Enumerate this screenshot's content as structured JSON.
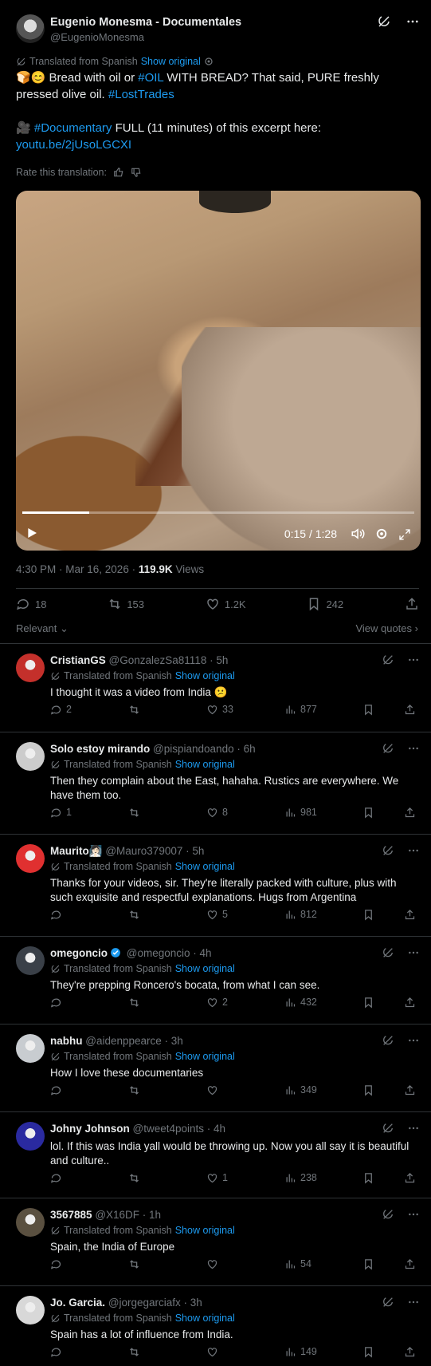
{
  "post": {
    "author_name": "Eugenio Monesma - Documentales",
    "author_handle": "@EugenioMonesma",
    "translated_label": "Translated from Spanish",
    "show_original": "Show original",
    "text_line1_emoji": "🍞😊",
    "text_line1_a": " Bread with oil or ",
    "hashtag_oil": "#OIL",
    "text_line1_b": " WITH BREAD? That said, PURE freshly pressed olive oil. ",
    "hashtag_lost": "#LostTrades",
    "text_line2_emoji": "🎥 ",
    "hashtag_doc": "#Documentary",
    "text_line2_b": " FULL (11 minutes) of this excerpt here:",
    "link": "youtu.be/2jUsoLGCXI",
    "rate_label": "Rate this translation:",
    "video_time": "0:15 / 1:28",
    "video_progress": 0.17,
    "timestamp": "4:30 PM · Mar 16, 2026 · ",
    "views_count": "119.9K",
    "views_label": " Views",
    "replies": "18",
    "reposts": "153",
    "likes": "1.2K",
    "bookmarks": "242",
    "sort_label": "Relevant",
    "view_quotes": "View quotes"
  },
  "replies": [
    {
      "name": "CristianGS",
      "handle": "@GonzalezSa81118 · 5h",
      "translated": true,
      "text": "I thought it was a video from India 😕",
      "comments": "2",
      "reposts": "",
      "likes": "33",
      "views": "877",
      "avatar": "#c4302b"
    },
    {
      "name": "Solo estoy mirando",
      "handle": "@pispiandoando · 6h",
      "translated": true,
      "text": "Then they complain about the East, hahaha. Rustics are everywhere. We have them too.",
      "comments": "1",
      "reposts": "",
      "likes": "8",
      "views": "981",
      "avatar": "#cccccc"
    },
    {
      "name": "Maurito🧖🏻‍♀️",
      "handle": "@Mauro379007 · 5h",
      "translated": true,
      "text": "Thanks for your videos, sir. They're literally packed with culture, plus with such exquisite and respectful explanations. Hugs from Argentina",
      "comments": "",
      "reposts": "",
      "likes": "5",
      "views": "812",
      "avatar": "#e03030"
    },
    {
      "name": "omegoncio",
      "handle": "@omegoncio · 4h",
      "translated": true,
      "text": "They're prepping Roncero's bocata, from what I can see.",
      "comments": "",
      "reposts": "",
      "likes": "2",
      "views": "432",
      "avatar": "#3a4048"
    },
    {
      "name": "nabhu",
      "handle": "@aidenppearce · 3h",
      "translated": true,
      "text": "How I love these documentaries",
      "comments": "",
      "reposts": "",
      "likes": "",
      "views": "349",
      "avatar": "#c8ccd0"
    },
    {
      "name": "Johny Johnson",
      "handle": "@tweet4points · 4h",
      "translated": false,
      "text": "lol. If this was India yall would be throwing up. Now you all say it is beautiful and culture..",
      "comments": "",
      "reposts": "",
      "likes": "1",
      "views": "238",
      "avatar": "#2a2aa0"
    },
    {
      "name": "3567885",
      "handle": "@X16DF · 1h",
      "translated": true,
      "text": "Spain, the India of Europe",
      "comments": "",
      "reposts": "",
      "likes": "",
      "views": "54",
      "avatar": "#5a5040"
    },
    {
      "name": "Jo. Garcia.",
      "handle": "@jorgegarciafx · 3h",
      "translated": true,
      "text": "Spain has a lot of influence from India.",
      "comments": "",
      "reposts": "",
      "likes": "",
      "views": "149",
      "avatar": "#d8d8d8"
    }
  ],
  "reply_translated_label": "Translated from Spanish",
  "reply_show_original": "Show original",
  "colors": {
    "accent": "#1d9bf0",
    "text": "#e7e9ea",
    "muted": "#71767b",
    "border": "#2f3336",
    "verified": "#1d9bf0"
  }
}
